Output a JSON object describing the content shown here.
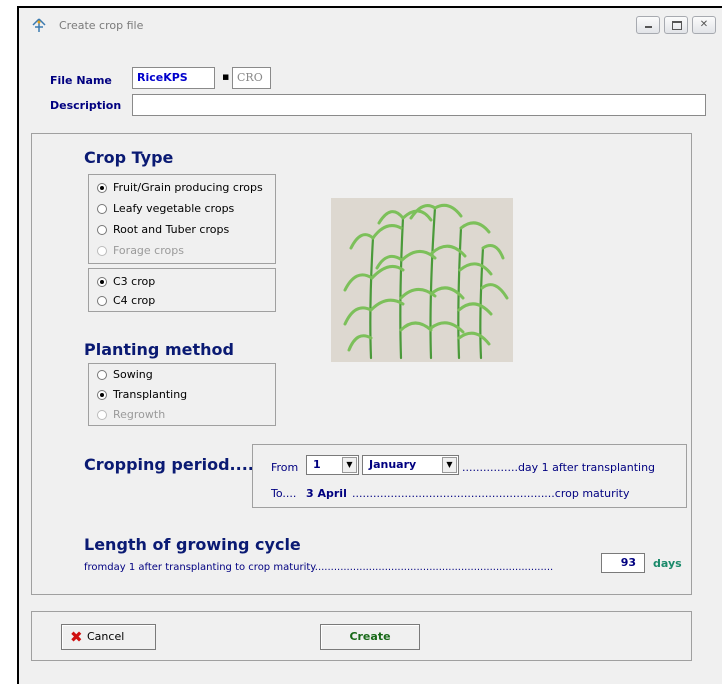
{
  "window": {
    "title": "Create crop file"
  },
  "file": {
    "name_label": "File Name",
    "name_value": "RiceKPS",
    "separator": "▪",
    "extension": "CRO",
    "description_label": "Description",
    "description_value": ""
  },
  "crop_type": {
    "title": "Crop Type",
    "options": [
      {
        "label": "Fruit/Grain producing crops",
        "checked": true,
        "disabled": false
      },
      {
        "label": "Leafy vegetable crops",
        "checked": false,
        "disabled": false
      },
      {
        "label": "Root and Tuber crops",
        "checked": false,
        "disabled": false
      },
      {
        "label": "Forage crops",
        "checked": false,
        "disabled": true
      }
    ],
    "photosynthesis": [
      {
        "label": "C3 crop",
        "checked": true
      },
      {
        "label": "C4 crop",
        "checked": false
      }
    ]
  },
  "planting": {
    "title": "Planting method",
    "options": [
      {
        "label": "Sowing",
        "checked": false,
        "disabled": false
      },
      {
        "label": "Transplanting",
        "checked": true,
        "disabled": false
      },
      {
        "label": "Regrowth",
        "checked": false,
        "disabled": true
      }
    ]
  },
  "period": {
    "title": "Cropping period......",
    "from_label": "From",
    "day_value": "1",
    "month_value": "January",
    "from_suffix": "................day 1 after transplanting",
    "to_prefix": "To....",
    "to_date": "3 April",
    "to_suffix": "..........................................................crop maturity"
  },
  "cycle": {
    "title": "Length of growing cycle",
    "description": "fromday 1 after transplanting to crop maturity...........................................................................",
    "value": "93",
    "unit": "days"
  },
  "buttons": {
    "cancel": "Cancel",
    "create": "Create"
  },
  "colors": {
    "title_blue": "#0a1a73",
    "label_blue": "#000080",
    "days_green": "#1a8a6a",
    "create_green": "#1a6a1a"
  }
}
